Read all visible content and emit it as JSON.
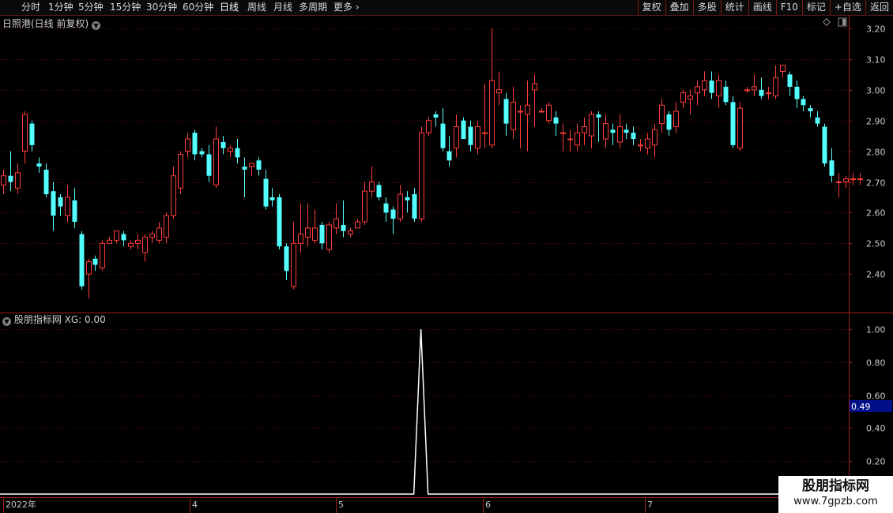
{
  "toolbar": {
    "periods": [
      "分时",
      "1分钟",
      "5分钟",
      "15分钟",
      "30分钟",
      "60分钟",
      "日线",
      "周线",
      "月线",
      "多周期",
      "更多"
    ],
    "active_period": "日线",
    "right_buttons": [
      "复权",
      "叠加",
      "多股",
      "统计",
      "画线",
      "F10",
      "标记",
      "+自选",
      "返回"
    ]
  },
  "main_title": "日照港(日线 前复权)",
  "indicator_title": "股朋指标网  XG: 0.00",
  "price_axis": [
    "3.20",
    "3.10",
    "3.00",
    "2.90",
    "2.80",
    "2.70",
    "2.60",
    "2.50",
    "2.40"
  ],
  "ind_axis": [
    "1.00",
    "0.80",
    "0.60",
    "0.40",
    "0.20"
  ],
  "cursor_value": "0.49",
  "date_axis": [
    "2022年",
    "4",
    "5",
    "6",
    "7"
  ],
  "logo": {
    "line1": "股朋指标网",
    "line2": "www.7gpzb.com"
  },
  "colors": {
    "up": "#ff3c3c",
    "down": "#54ffff",
    "grid": "#6e1010",
    "border": "#9e1e1e",
    "signal": "#ffffff",
    "cursor_box": "#000f8a"
  },
  "chart_data": [
    {
      "type": "candlestick",
      "title": "日照港(日线 前复权)",
      "ylim": [
        2.29,
        3.23
      ],
      "x_labels": [
        "2022年",
        "4",
        "5",
        "6",
        "7"
      ],
      "candles": [
        [
          2.69,
          2.72,
          2.66,
          2.74
        ],
        [
          2.72,
          2.7,
          2.67,
          2.8
        ],
        [
          2.68,
          2.73,
          2.66,
          2.76
        ],
        [
          2.8,
          2.92,
          2.76,
          2.93
        ],
        [
          2.89,
          2.82,
          2.8,
          2.9
        ],
        [
          2.76,
          2.75,
          2.73,
          2.78
        ],
        [
          2.74,
          2.66,
          2.65,
          2.76
        ],
        [
          2.67,
          2.59,
          2.54,
          2.7
        ],
        [
          2.65,
          2.62,
          2.59,
          2.66
        ],
        [
          2.59,
          2.65,
          2.57,
          2.69
        ],
        [
          2.64,
          2.57,
          2.55,
          2.68
        ],
        [
          2.53,
          2.36,
          2.35,
          2.54
        ],
        [
          2.4,
          2.44,
          2.32,
          2.45
        ],
        [
          2.45,
          2.43,
          2.41,
          2.46
        ],
        [
          2.42,
          2.5,
          2.41,
          2.51
        ],
        [
          2.5,
          2.51,
          2.5,
          2.52
        ],
        [
          2.51,
          2.54,
          2.5,
          2.54
        ],
        [
          2.53,
          2.51,
          2.49,
          2.54
        ],
        [
          2.49,
          2.5,
          2.48,
          2.51
        ],
        [
          2.5,
          2.51,
          2.48,
          2.53
        ],
        [
          2.47,
          2.52,
          2.44,
          2.53
        ],
        [
          2.52,
          2.53,
          2.5,
          2.54
        ],
        [
          2.51,
          2.55,
          2.5,
          2.57
        ],
        [
          2.52,
          2.59,
          2.5,
          2.6
        ],
        [
          2.59,
          2.72,
          2.58,
          2.75
        ],
        [
          2.68,
          2.79,
          2.66,
          2.8
        ],
        [
          2.8,
          2.84,
          2.78,
          2.86
        ],
        [
          2.86,
          2.79,
          2.77,
          2.87
        ],
        [
          2.8,
          2.79,
          2.78,
          2.81
        ],
        [
          2.79,
          2.72,
          2.7,
          2.82
        ],
        [
          2.69,
          2.84,
          2.68,
          2.88
        ],
        [
          2.83,
          2.81,
          2.79,
          2.85
        ],
        [
          2.8,
          2.81,
          2.78,
          2.82
        ],
        [
          2.81,
          2.78,
          2.76,
          2.84
        ],
        [
          2.75,
          2.74,
          2.65,
          2.78
        ],
        [
          2.75,
          2.76,
          2.72,
          2.76
        ],
        [
          2.77,
          2.74,
          2.72,
          2.78
        ],
        [
          2.71,
          2.62,
          2.61,
          2.74
        ],
        [
          2.65,
          2.64,
          2.62,
          2.68
        ],
        [
          2.65,
          2.49,
          2.48,
          2.66
        ],
        [
          2.49,
          2.41,
          2.38,
          2.5
        ],
        [
          2.36,
          2.5,
          2.35,
          2.57
        ],
        [
          2.5,
          2.53,
          2.47,
          2.63
        ],
        [
          2.52,
          2.55,
          2.49,
          2.63
        ],
        [
          2.51,
          2.55,
          2.5,
          2.61
        ],
        [
          2.56,
          2.5,
          2.48,
          2.57
        ],
        [
          2.48,
          2.56,
          2.47,
          2.57
        ],
        [
          2.55,
          2.58,
          2.53,
          2.63
        ],
        [
          2.56,
          2.54,
          2.52,
          2.64
        ],
        [
          2.53,
          2.54,
          2.52,
          2.55
        ],
        [
          2.55,
          2.57,
          2.55,
          2.58
        ],
        [
          2.57,
          2.67,
          2.56,
          2.7
        ],
        [
          2.67,
          2.7,
          2.65,
          2.75
        ],
        [
          2.69,
          2.65,
          2.64,
          2.7
        ],
        [
          2.63,
          2.6,
          2.57,
          2.65
        ],
        [
          2.61,
          2.58,
          2.53,
          2.62
        ],
        [
          2.58,
          2.66,
          2.57,
          2.69
        ],
        [
          2.65,
          2.64,
          2.6,
          2.67
        ],
        [
          2.66,
          2.58,
          2.57,
          2.68
        ],
        [
          2.58,
          2.86,
          2.57,
          2.88
        ],
        [
          2.86,
          2.9,
          2.85,
          2.91
        ],
        [
          2.92,
          2.91,
          2.88,
          2.93
        ],
        [
          2.89,
          2.81,
          2.8,
          2.94
        ],
        [
          2.8,
          2.77,
          2.75,
          2.85
        ],
        [
          2.81,
          2.88,
          2.78,
          2.92
        ],
        [
          2.9,
          2.84,
          2.84,
          2.91
        ],
        [
          2.88,
          2.82,
          2.8,
          2.9
        ],
        [
          2.81,
          2.88,
          2.79,
          2.9
        ],
        [
          2.86,
          2.86,
          2.81,
          3.02
        ],
        [
          2.82,
          3.03,
          2.81,
          3.2
        ],
        [
          2.99,
          3.0,
          2.95,
          3.06
        ],
        [
          2.97,
          2.89,
          2.85,
          2.99
        ],
        [
          2.87,
          2.96,
          2.84,
          3.01
        ],
        [
          2.93,
          2.93,
          2.81,
          2.95
        ],
        [
          2.92,
          2.95,
          2.8,
          3.03
        ],
        [
          3.0,
          3.02,
          2.88,
          3.05
        ],
        [
          2.93,
          2.93,
          2.93,
          2.94
        ],
        [
          2.9,
          2.95,
          2.89,
          2.96
        ],
        [
          2.91,
          2.89,
          2.85,
          2.93
        ],
        [
          2.86,
          2.86,
          2.8,
          2.89
        ],
        [
          2.84,
          2.84,
          2.8,
          2.87
        ],
        [
          2.82,
          2.86,
          2.8,
          2.89
        ],
        [
          2.86,
          2.88,
          2.82,
          2.91
        ],
        [
          2.85,
          2.92,
          2.81,
          2.93
        ],
        [
          2.92,
          2.91,
          2.83,
          2.93
        ],
        [
          2.84,
          2.89,
          2.81,
          2.92
        ],
        [
          2.87,
          2.86,
          2.82,
          2.89
        ],
        [
          2.83,
          2.88,
          2.81,
          2.92
        ],
        [
          2.87,
          2.86,
          2.84,
          2.89
        ],
        [
          2.86,
          2.84,
          2.82,
          2.88
        ],
        [
          2.82,
          2.82,
          2.8,
          2.84
        ],
        [
          2.81,
          2.84,
          2.79,
          2.86
        ],
        [
          2.82,
          2.87,
          2.78,
          2.89
        ],
        [
          2.89,
          2.95,
          2.86,
          2.97
        ],
        [
          2.92,
          2.87,
          2.85,
          2.93
        ],
        [
          2.88,
          2.93,
          2.86,
          2.96
        ],
        [
          2.96,
          2.99,
          2.94,
          3.0
        ],
        [
          2.97,
          2.98,
          2.92,
          3.0
        ],
        [
          2.99,
          3.01,
          2.95,
          3.03
        ],
        [
          3.0,
          3.03,
          2.98,
          3.06
        ],
        [
          3.03,
          2.99,
          2.97,
          3.06
        ],
        [
          2.98,
          3.03,
          2.94,
          3.05
        ],
        [
          3.01,
          2.96,
          2.95,
          3.03
        ],
        [
          2.96,
          2.82,
          2.81,
          2.98
        ],
        [
          2.81,
          2.94,
          2.8,
          2.96
        ],
        [
          3.0,
          3.0,
          2.99,
          3.01
        ],
        [
          3.0,
          3.01,
          2.98,
          3.05
        ],
        [
          3.0,
          2.98,
          2.97,
          3.04
        ],
        [
          2.99,
          2.99,
          2.97,
          3.01
        ],
        [
          2.98,
          3.04,
          2.97,
          3.08
        ],
        [
          3.06,
          3.08,
          3.04,
          3.08
        ],
        [
          3.05,
          3.01,
          2.98,
          3.06
        ],
        [
          3.01,
          2.97,
          2.94,
          3.03
        ],
        [
          2.97,
          2.95,
          2.93,
          2.98
        ],
        [
          2.94,
          2.93,
          2.91,
          2.95
        ],
        [
          2.91,
          2.89,
          2.88,
          2.93
        ],
        [
          2.88,
          2.76,
          2.75,
          2.89
        ],
        [
          2.77,
          2.72,
          2.7,
          2.81
        ],
        [
          2.7,
          2.7,
          2.65,
          2.73
        ],
        [
          2.7,
          2.71,
          2.68,
          2.72
        ],
        [
          2.71,
          2.71,
          2.69,
          2.73
        ],
        [
          2.71,
          2.71,
          2.69,
          2.73
        ]
      ]
    },
    {
      "type": "line",
      "title": "股朋指标网  XG: 0.00",
      "ylim": [
        0,
        1.06
      ],
      "series": [
        {
          "name": "XG",
          "signal_index": 59,
          "values_note_peak": 1.0
        }
      ]
    }
  ]
}
